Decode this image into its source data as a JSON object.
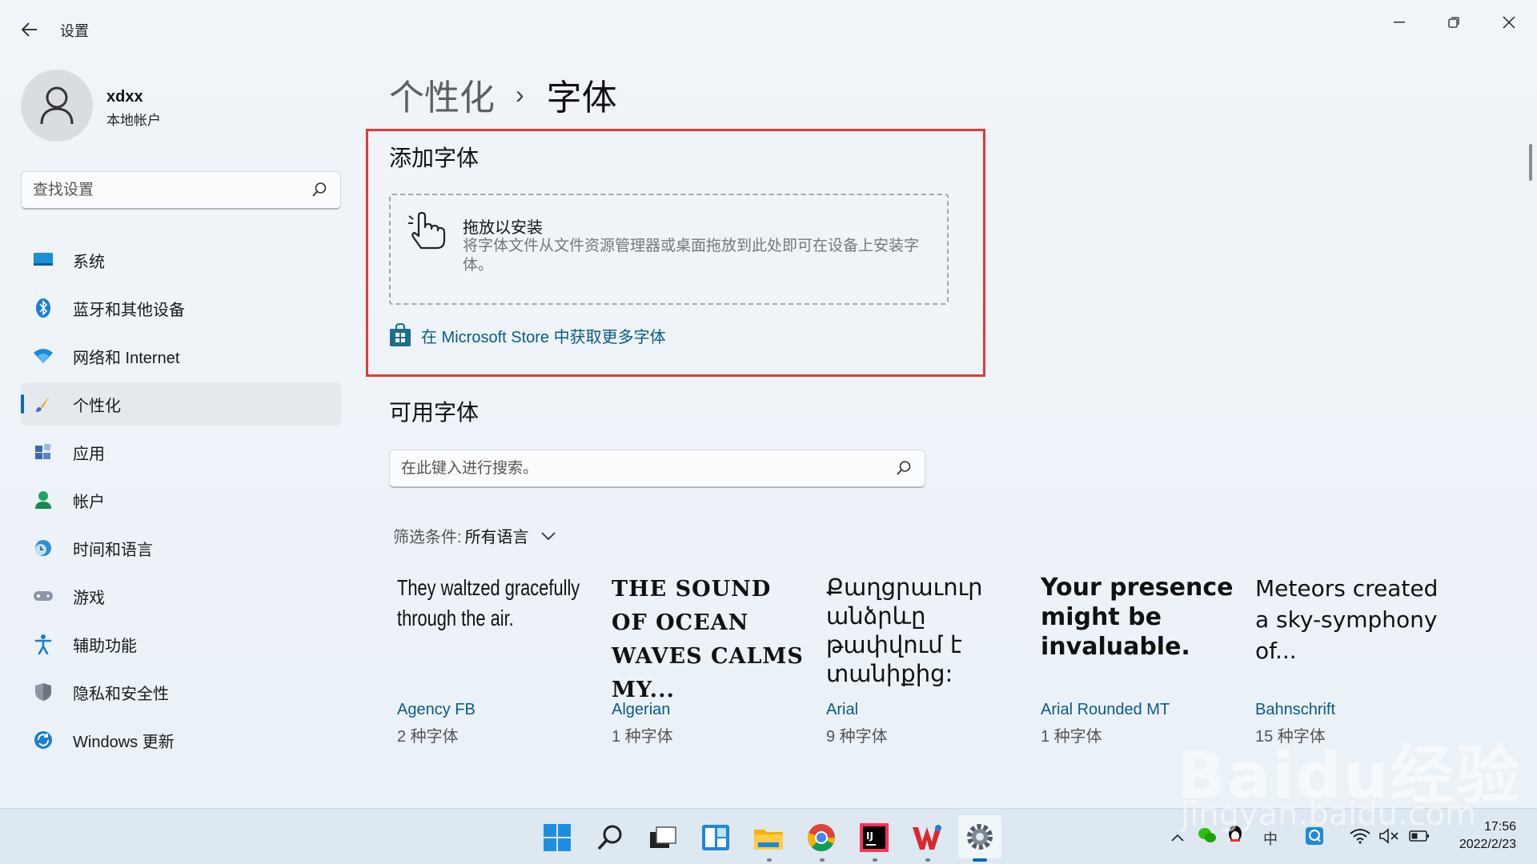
{
  "window": {
    "title": "设置"
  },
  "profile": {
    "name": "xdxx",
    "type": "本地帐户"
  },
  "search": {
    "placeholder": "查找设置"
  },
  "sidebar": {
    "items": [
      {
        "label": "系统",
        "icon": "system-icon"
      },
      {
        "label": "蓝牙和其他设备",
        "icon": "bluetooth-icon"
      },
      {
        "label": "网络和 Internet",
        "icon": "wifi-icon"
      },
      {
        "label": "个性化",
        "icon": "brush-icon",
        "active": true
      },
      {
        "label": "应用",
        "icon": "apps-icon"
      },
      {
        "label": "帐户",
        "icon": "account-icon"
      },
      {
        "label": "时间和语言",
        "icon": "globe-clock-icon"
      },
      {
        "label": "游戏",
        "icon": "gamepad-icon"
      },
      {
        "label": "辅助功能",
        "icon": "accessibility-icon"
      },
      {
        "label": "隐私和安全性",
        "icon": "shield-icon"
      },
      {
        "label": "Windows 更新",
        "icon": "update-icon"
      }
    ]
  },
  "breadcrumb": {
    "parent": "个性化",
    "separator": "›",
    "current": "字体"
  },
  "add_fonts": {
    "title": "添加字体",
    "drop_title": "拖放以安装",
    "drop_desc": "将字体文件从文件资源管理器或桌面拖放到此处即可在设备上安装字体。",
    "store_link": "在 Microsoft Store 中获取更多字体"
  },
  "available_fonts": {
    "title": "可用字体",
    "search_placeholder": "在此键入进行搜索。",
    "filter_label": "筛选条件:",
    "filter_value": "所有语言",
    "fonts": [
      {
        "sample": "They waltzed gracefully through the air.",
        "name": "Agency FB",
        "count": "2 种字体"
      },
      {
        "sample": "THE SOUND OF OCEAN WAVES CALMS MY...",
        "name": "Algerian",
        "count": "1 种字体"
      },
      {
        "sample": "Քաղցրաւուր անձրևը թափվում է տանիքից:",
        "name": "Arial",
        "count": "9 种字体"
      },
      {
        "sample": "Your presence might be invaluable.",
        "name": "Arial Rounded MT",
        "count": "1 种字体"
      },
      {
        "sample": "Meteors created a sky-symphony of...",
        "name": "Bahnschrift",
        "count": "15 种字体"
      }
    ]
  },
  "taskbar": {
    "apps": [
      "start-icon",
      "search-icon",
      "task-view-icon",
      "widgets-icon",
      "file-explorer-icon",
      "chrome-icon",
      "intellij-icon",
      "wps-icon",
      "settings-icon"
    ],
    "ime": "中",
    "time": "17:56",
    "date": "2022/2/23"
  },
  "watermark": {
    "main": "Baidu经验",
    "sub": "jingyan.baidu.com"
  },
  "colors": {
    "accent": "#0a6aa8",
    "highlight_border": "#e53935",
    "link": "#0b5a8a"
  }
}
